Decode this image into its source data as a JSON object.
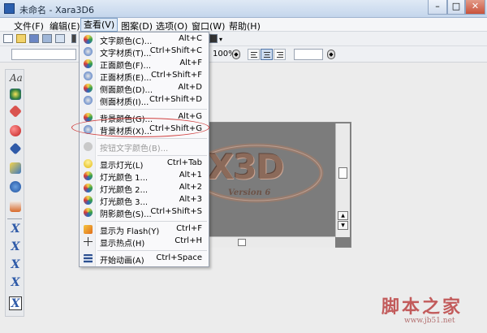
{
  "window": {
    "title": "未命名 - Xara3D6",
    "minimize_glyph": "–",
    "maximize_glyph": "□",
    "close_glyph": "✕"
  },
  "menubar": {
    "items": [
      {
        "label": "文件(F)"
      },
      {
        "label": "编辑(E)"
      },
      {
        "label": "查看(V)",
        "active": true
      },
      {
        "label": "图案(D)"
      },
      {
        "label": "选项(O)"
      },
      {
        "label": "窗口(W)"
      },
      {
        "label": "帮助(H)"
      }
    ]
  },
  "toolbar2": {
    "zoom_value": "100%"
  },
  "side_toolbar": {
    "font_glyph": "Aa",
    "x_glyph": "X"
  },
  "dropdown": {
    "items": [
      {
        "label": "文字颜色(C)...",
        "shortcut": "Alt+C",
        "icon": "color-wheel-icon"
      },
      {
        "label": "文字材质(T)...",
        "shortcut": "Ctrl+Shift+C",
        "icon": "texture-icon"
      },
      {
        "label": "正面颜色(F)...",
        "shortcut": "Alt+F",
        "icon": "color-wheel-icon"
      },
      {
        "label": "正面材质(E)...",
        "shortcut": "Ctrl+Shift+F",
        "icon": "texture-icon"
      },
      {
        "label": "侧面颜色(D)...",
        "shortcut": "Alt+D",
        "icon": "color-wheel-icon"
      },
      {
        "label": "侧面材质(I)...",
        "shortcut": "Ctrl+Shift+D",
        "icon": "texture-icon"
      },
      {
        "label": "背景颜色(G)...",
        "shortcut": "Alt+G",
        "icon": "color-wheel-icon"
      },
      {
        "label": "背景材质(X)...",
        "shortcut": "Ctrl+Shift+G",
        "icon": "texture-icon"
      },
      {
        "label": "按钮文字颜色(B)...",
        "shortcut": "",
        "icon": "color-wheel-icon",
        "disabled": true
      },
      {
        "label": "显示灯光(L)",
        "shortcut": "Ctrl+Tab",
        "icon": "light-bulb-icon"
      },
      {
        "label": "灯光颜色 1...",
        "shortcut": "Alt+1",
        "icon": "color-wheel-icon"
      },
      {
        "label": "灯光颜色 2...",
        "shortcut": "Alt+2",
        "icon": "color-wheel-icon"
      },
      {
        "label": "灯光颜色 3...",
        "shortcut": "Alt+3",
        "icon": "color-wheel-icon"
      },
      {
        "label": "阴影颜色(S)...",
        "shortcut": "Ctrl+Shift+S",
        "icon": "color-wheel-icon"
      },
      {
        "label": "显示为 Flash(Y)",
        "shortcut": "Ctrl+F",
        "icon": "flash-icon"
      },
      {
        "label": "显示热点(H)",
        "shortcut": "Ctrl+H",
        "icon": "crosshair-icon"
      },
      {
        "label": "开始动画(A)",
        "shortcut": "Ctrl+Space",
        "icon": "film-icon"
      }
    ]
  },
  "canvas": {
    "logo_text": "X3D",
    "logo_subtitle": "Version 6"
  },
  "watermark": {
    "text": "脚本之家",
    "url": "www.jb51.net"
  },
  "colors": {
    "menu_highlight": "#dde8f5",
    "canvas_bg": "#7c7c7c",
    "logo_fill": "#8b6a5a",
    "annotation_red": "#d04040",
    "watermark_red": "#c25b5b"
  }
}
